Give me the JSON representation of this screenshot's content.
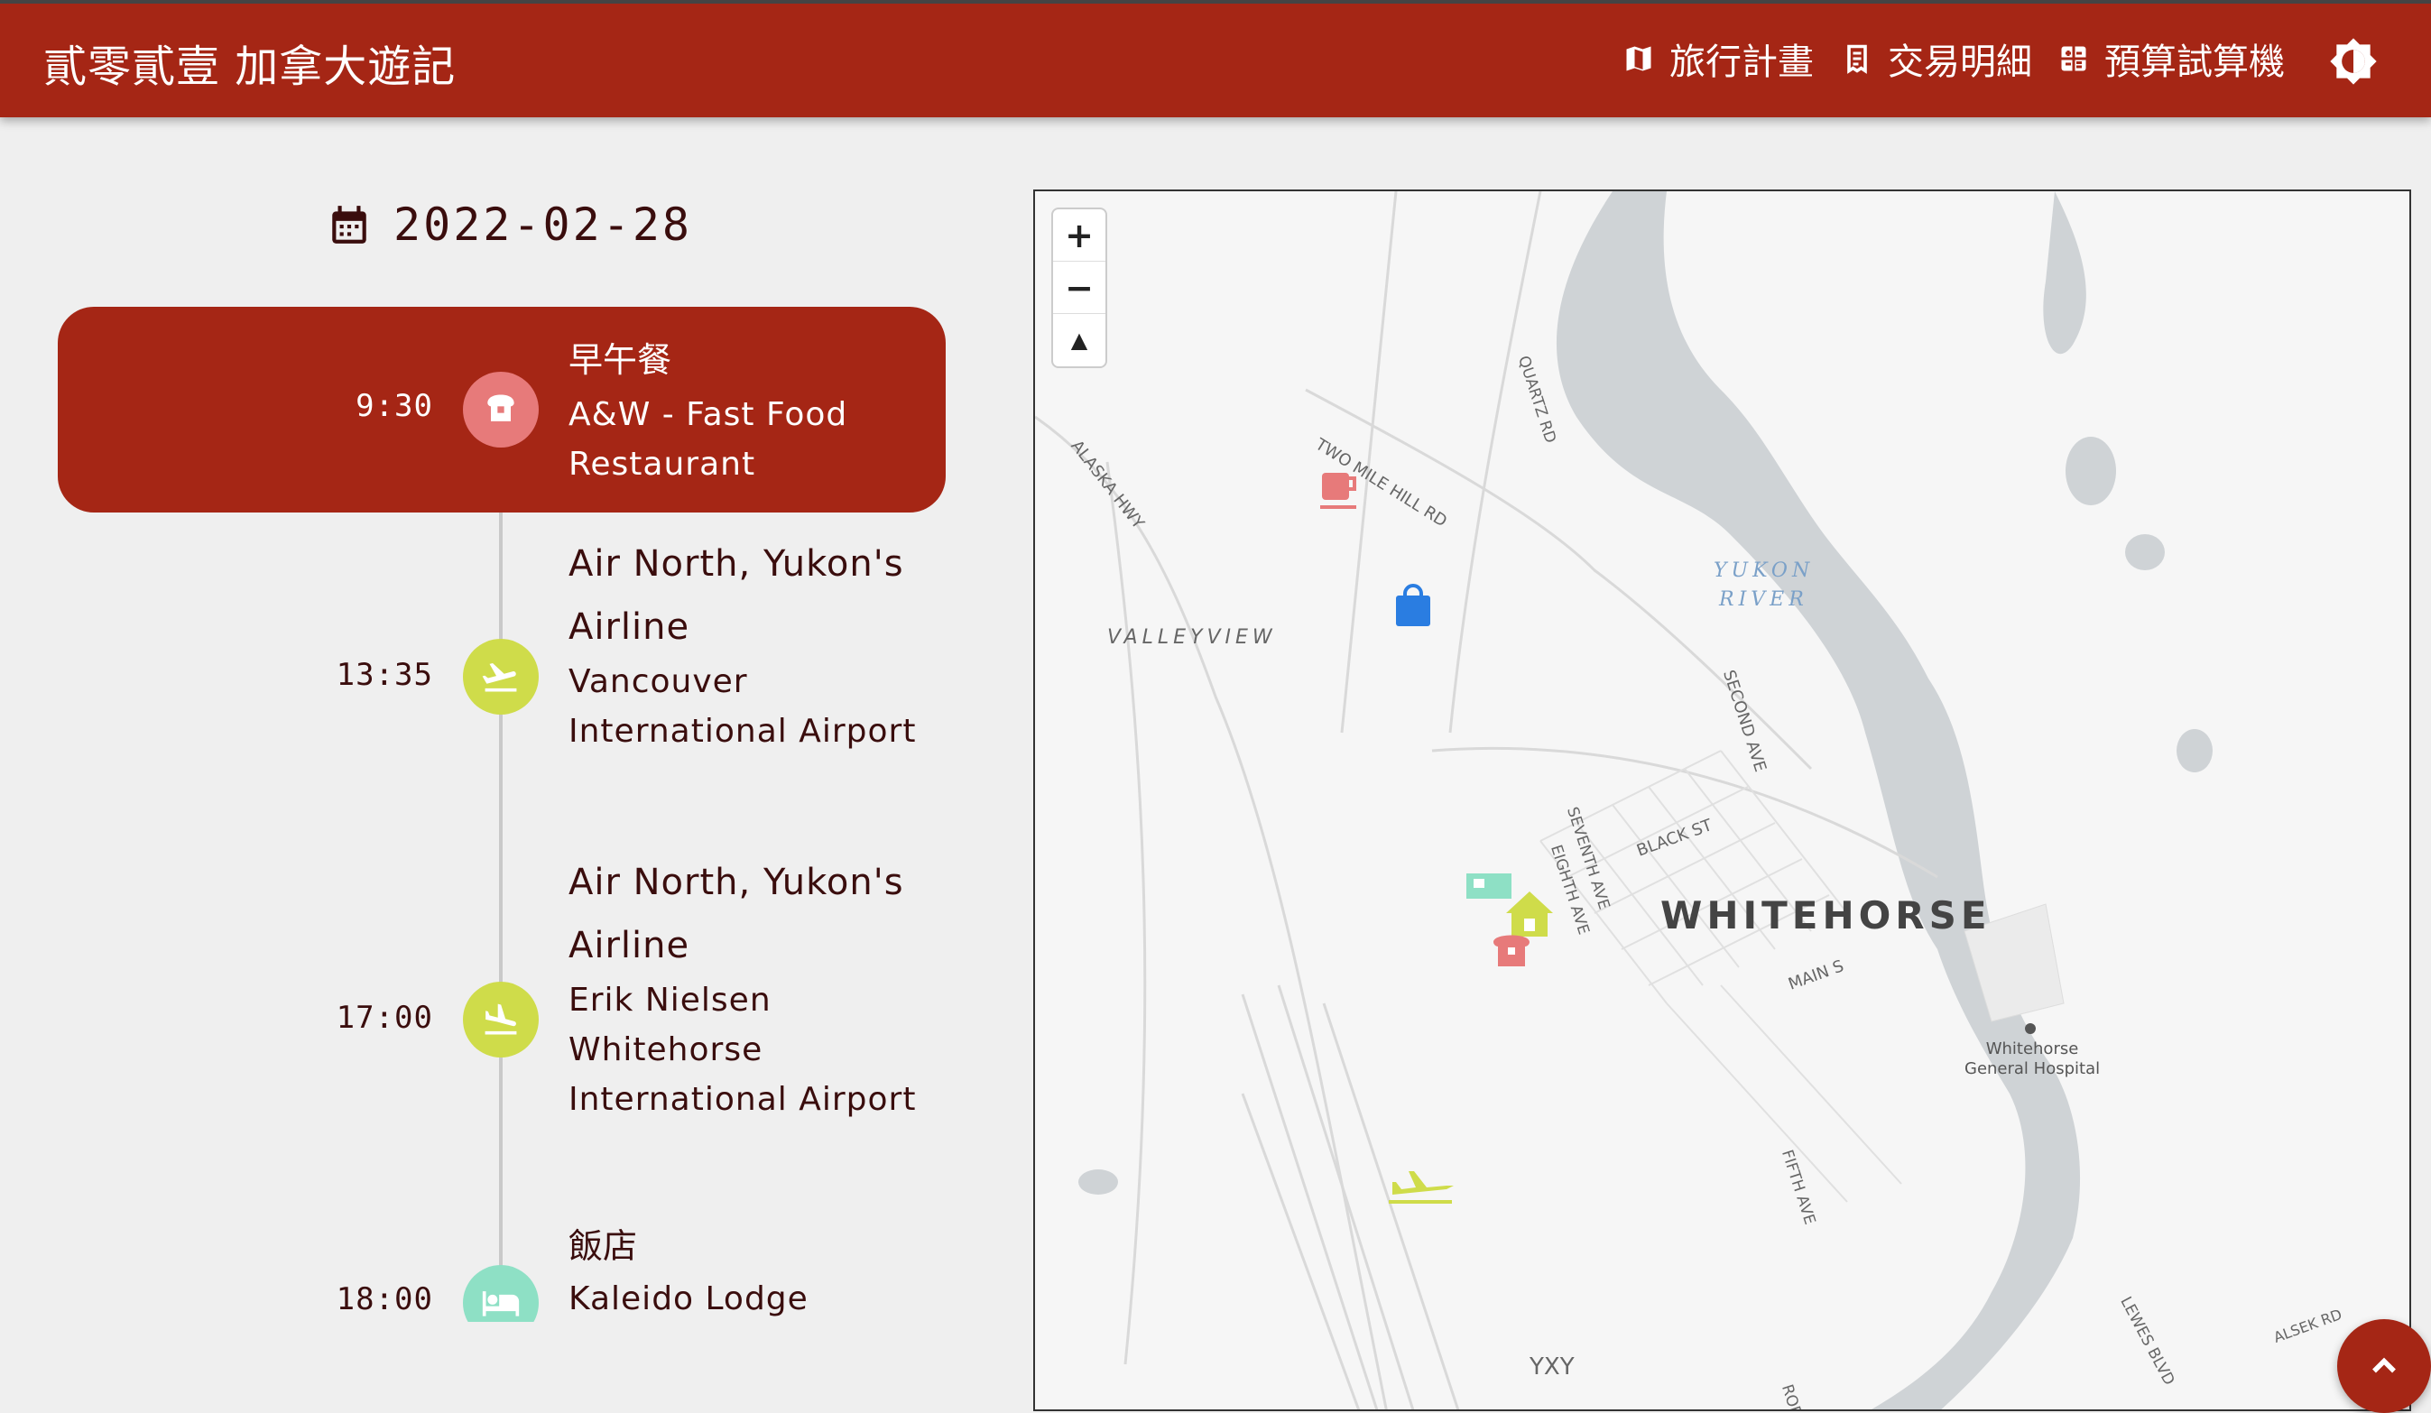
{
  "app": {
    "title": "貳零貳壹 加拿大遊記"
  },
  "nav": [
    {
      "label": "旅行計畫",
      "icon": "map-icon"
    },
    {
      "label": "交易明細",
      "icon": "receipt-icon"
    },
    {
      "label": "預算試算機",
      "icon": "calculator-icon"
    }
  ],
  "theme_icon": "brightness-icon",
  "date": "2022-02-28",
  "events": [
    {
      "time": "9:30",
      "category": "早午餐",
      "place": "A&W - Fast Food Restaurant",
      "icon": "restaurant-icon",
      "color": "#e77a7a",
      "active": true
    },
    {
      "time": "13:35",
      "name": "Air North, Yukon's Airline",
      "place": "Vancouver International Airport",
      "icon": "flight-takeoff-icon",
      "color": "#cfdc4a"
    },
    {
      "time": "17:00",
      "name": "Air North, Yukon's Airline",
      "place": "Erik Nielsen Whitehorse International Airport",
      "icon": "flight-land-icon",
      "color": "#cfdc4a"
    },
    {
      "time": "18:00",
      "category": "飯店",
      "place": "Kaleido Lodge",
      "icon": "hotel-icon",
      "color": "#8ee0c5"
    }
  ],
  "map": {
    "zoom_in": "+",
    "zoom_out": "−",
    "reset": "▲",
    "labels": {
      "whitehorse": "WHITEHORSE",
      "valleyview": "VALLEYVIEW",
      "yukon": "YUKON",
      "river": "RIVER",
      "two_mile": "TWO MILE HILL RD",
      "alaska": "ALASKA HWY",
      "quartz": "QUARTZ RD",
      "second": "SECOND AVE",
      "black": "BLACK ST",
      "seventh": "SEVENTH AVE",
      "eighth": "EIGHTH AVE",
      "main": "MAIN S",
      "fifth": "FIFTH AVE",
      "hospital1": "Whitehorse",
      "hospital2": "General Hospital",
      "lewes": "LEWES BLVD",
      "alsek": "ALSEK RD",
      "yxy": "YXY",
      "rob": "ROB"
    },
    "markers": [
      {
        "icon": "cafe-marker-icon",
        "color": "#e77a7a"
      },
      {
        "icon": "shopping-marker-icon",
        "color": "#2a7de1"
      },
      {
        "icon": "hotel-marker-icon",
        "color": "#8ee0c5"
      },
      {
        "icon": "home-marker-icon",
        "color": "#cfdc4a"
      },
      {
        "icon": "restaurant-marker-icon",
        "color": "#e77a7a"
      },
      {
        "icon": "airport-marker-icon",
        "color": "#cfdc4a"
      }
    ]
  },
  "colors": {
    "brand": "#a52615",
    "text": "#3a0d0d",
    "background": "#efefef"
  }
}
